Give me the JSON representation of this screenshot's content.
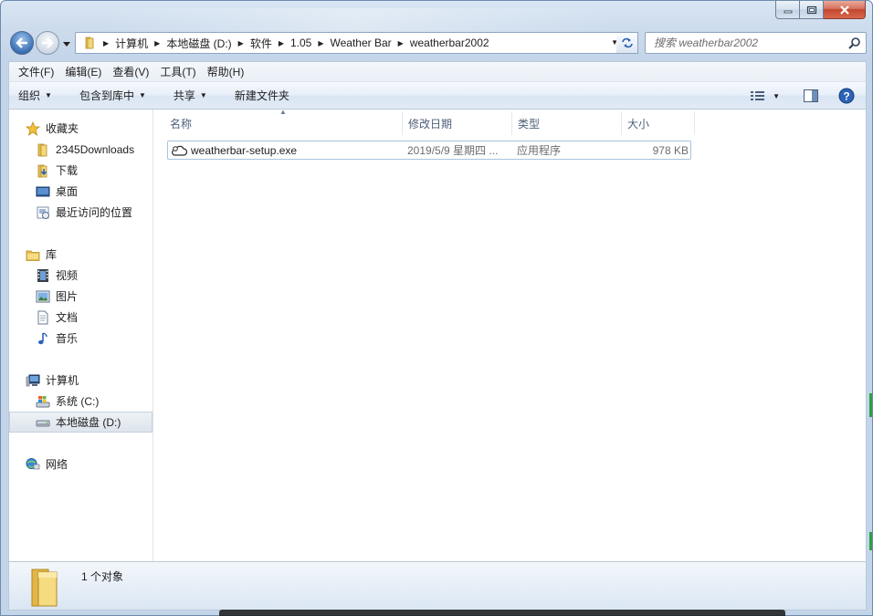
{
  "window": {
    "caption": {
      "minimize": "minimize",
      "maximize": "maximize",
      "close": "close"
    }
  },
  "address": {
    "crumbs": [
      "计算机",
      "本地磁盘 (D:)",
      "软件",
      "1.05",
      "Weather Bar",
      "weatherbar2002"
    ]
  },
  "search": {
    "placeholder": "搜索 weatherbar2002"
  },
  "menu": [
    "文件(F)",
    "编辑(E)",
    "查看(V)",
    "工具(T)",
    "帮助(H)"
  ],
  "commands": [
    "组织",
    "包含到库中",
    "共享",
    "新建文件夹"
  ],
  "nav": {
    "favorites": {
      "label": "收藏夹",
      "items": [
        "2345Downloads",
        "下载",
        "桌面",
        "最近访问的位置"
      ]
    },
    "libraries": {
      "label": "库",
      "items": [
        "视频",
        "图片",
        "文档",
        "音乐"
      ]
    },
    "computer": {
      "label": "计算机",
      "items": [
        "系统 (C:)",
        "本地磁盘 (D:)"
      ]
    },
    "network": {
      "label": "网络"
    }
  },
  "columns": [
    "名称",
    "修改日期",
    "类型",
    "大小"
  ],
  "files": [
    {
      "name": "weatherbar-setup.exe",
      "date": "2019/5/9 星期四 ...",
      "type": "应用程序",
      "size": "978 KB"
    }
  ],
  "details": {
    "count": "1 个对象"
  },
  "colors": {
    "selection_border": "#a9c3de",
    "chrome": "#c4d5e9",
    "close": "#c3472f"
  }
}
